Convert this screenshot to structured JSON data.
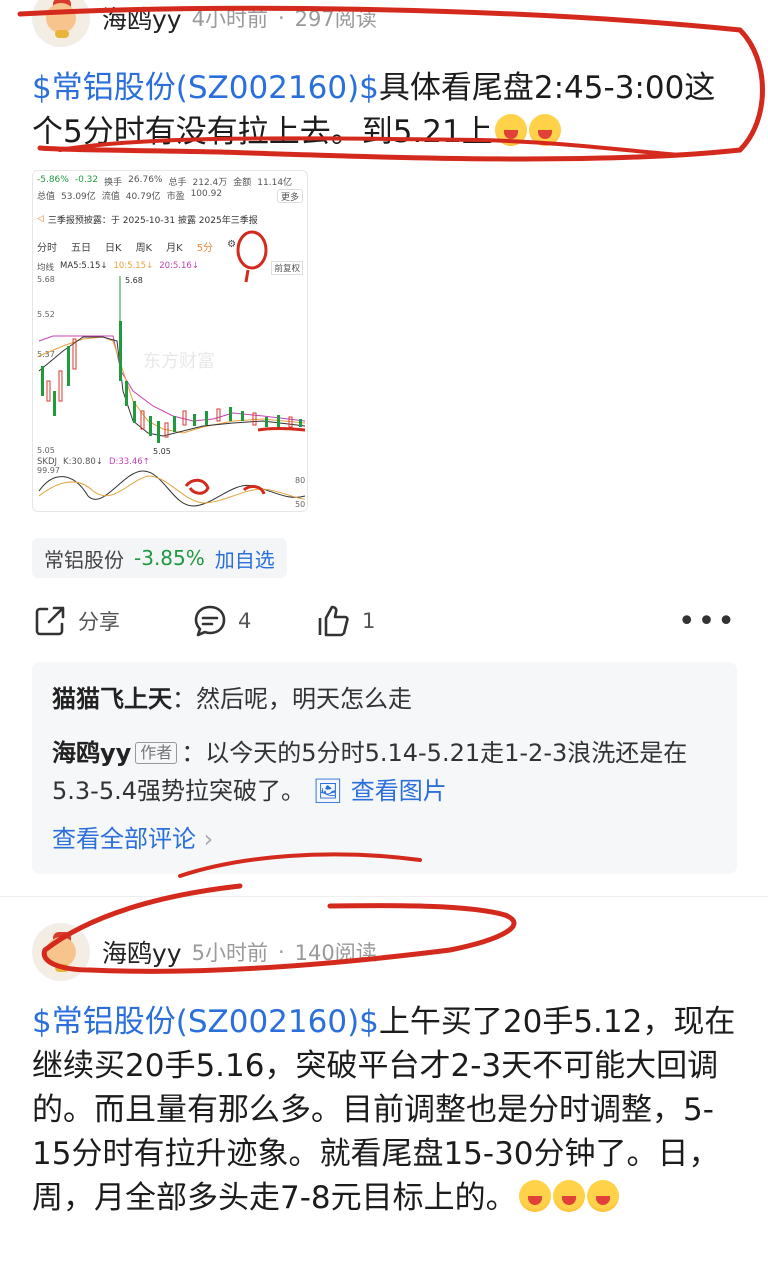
{
  "posts": [
    {
      "author": "海鸥yy",
      "time": "4小时前",
      "reads": "297阅读",
      "stock_tag": "$常铝股份(SZ002160)$",
      "body": "具体看尾盘2:45-3:00这个5分时有没有拉上去。到5.21上",
      "emoji_count": 2
    },
    {
      "author": "海鸥yy",
      "time": "5小时前",
      "reads": "140阅读",
      "stock_tag": "$常铝股份(SZ002160)$",
      "body": "上午买了20手5.12，现在继续买20手5.16，突破平台才2-3天不可能大回调的。而且量有那么多。目前调整也是分时调整，5-15分时有拉升迹象。就看尾盘15-30分钟了。日，周，月全部多头走7-8元目标上的。",
      "emoji_count": 3
    }
  ],
  "thumbnail": {
    "change_pct": "-5.86%",
    "change_val": "-0.32",
    "turnover_label": "换手",
    "turnover": "26.76%",
    "total_hands_label": "总手",
    "total_hands": "212.4万",
    "amount_label": "金额",
    "amount": "11.14亿",
    "market_cap_label": "总值",
    "market_cap": "53.09亿",
    "float_label": "流值",
    "float_cap": "40.79亿",
    "pe_label": "市盈",
    "pe": "100.92",
    "more": "更多",
    "notice": "三季报预披露：于 2025-10-31 披露 2025年三季报",
    "periods": [
      "分时",
      "五日",
      "日K",
      "周K",
      "月K",
      "5分"
    ],
    "ma_type": "均线",
    "ma5": "MA5:5.15↓",
    "ma10": "10:5.15↓",
    "ma20": "20:5.16↓",
    "fq": "前复权",
    "y_high": "5.68",
    "y_mid1": "5.52",
    "y_mid2": "5.37",
    "y_low": "5.05",
    "hi_mark": "5.68",
    "lo_mark": "5.05",
    "kdj_label": "SKDJ",
    "kdj_k": "K:30.80↓",
    "kdj_d": "D:33.46↑",
    "kdj_top": "99.97",
    "kdj_80": "80",
    "kdj_50": "50",
    "watermark": "东方财富"
  },
  "stock_chip": {
    "name": "常铝股份",
    "change": "-3.85%",
    "add": "加自选"
  },
  "actions": {
    "share": "分享",
    "comments": "4",
    "likes": "1"
  },
  "comments": {
    "c1_name": "猫猫飞上天",
    "c1_text": "：然后呢，明天怎么走",
    "c2_name": "海鸥yy",
    "c2_badge": "作者",
    "c2_text": "：以今天的5分时5.14-5.21走1-2-3浪洗还是在5.3-5.4强势拉突破了。",
    "c2_link": "查看图片",
    "view_all": "查看全部评论"
  },
  "colors": {
    "link_blue": "#2a6fdb",
    "down_green": "#1f9a3f",
    "annotation_red": "#d42a1e"
  }
}
